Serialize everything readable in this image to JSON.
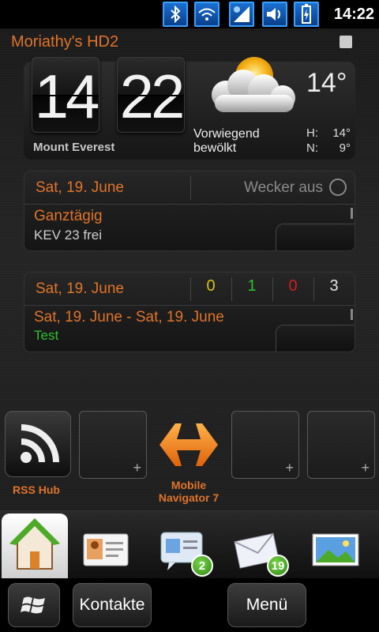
{
  "status_bar": {
    "time": "14:22",
    "icons": [
      "bluetooth-icon",
      "wifi-icon",
      "signal-icon",
      "volume-icon",
      "battery-icon"
    ]
  },
  "owner_name": "Moriathy's HD2",
  "clock": {
    "hour": "14",
    "minute": "22"
  },
  "weather": {
    "location": "Mount Everest",
    "description_line1": "Vorwiegend",
    "description_line2": "bewölkt",
    "temperature": "14°",
    "high_label": "H:",
    "high_value": "14°",
    "low_label": "N:",
    "low_value": "9°"
  },
  "calendar_card": {
    "date": "Sat, 19. June",
    "alarm_text": "Wecker aus",
    "event_title": "Ganztägig",
    "event_detail": "KEV 23 frei"
  },
  "tasks_card": {
    "date": "Sat, 19. June",
    "counts": [
      {
        "value": "0",
        "color": "#d8c21a"
      },
      {
        "value": "1",
        "color": "#2ec22e"
      },
      {
        "value": "0",
        "color": "#d01e1e"
      },
      {
        "value": "3",
        "color": "#e0e0e0"
      }
    ],
    "range": "Sat, 19. June - Sat, 19. June",
    "task": "Test"
  },
  "launcher": {
    "rss_label": "RSS Hub",
    "nav_label_line1": "Mobile",
    "nav_label_line2": "Navigator 7",
    "plus": "+"
  },
  "tabs": {
    "items": [
      "home-tab",
      "contacts-tab",
      "messages-tab",
      "mail-tab",
      "photos-tab"
    ],
    "messages_badge": "2",
    "mail_badge": "19"
  },
  "softkeys": {
    "contacts": "Kontakte",
    "menu": "Menü"
  },
  "colors": {
    "accent_orange": "#e0742a",
    "status_blue": "#1b6fd0",
    "task_green": "#2ec22e"
  }
}
